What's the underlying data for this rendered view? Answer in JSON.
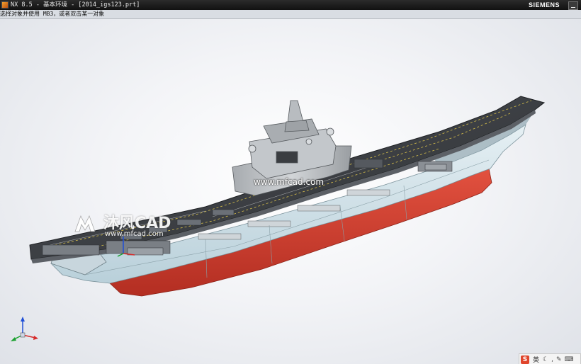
{
  "window": {
    "title": "NX 8.5 - 基本环境 - [2014_igs123.prt]",
    "brand": "SIEMENS"
  },
  "cue_line": {
    "text": "选择对象并使用 MB3，或者双击某一对象"
  },
  "viewport": {
    "model": "aircraft-carrier",
    "watermark_url": "www.mfcad.com",
    "logo_text": "沐风CAD",
    "logo_sub": "www.mfcad.com"
  },
  "ime_bar": {
    "logo": "S",
    "lang": "英",
    "icons": [
      "moon-icon",
      "comma-icon",
      "pen-icon",
      "keyboard-icon"
    ]
  },
  "colors": {
    "hull_red": "#d6402f",
    "hull_light": "#cfe1e9",
    "deck": "#3e4146",
    "island": "#b9bdc1",
    "triad_x": "#d62b2b",
    "triad_y": "#1aa12f",
    "triad_z": "#1f4fd6"
  }
}
